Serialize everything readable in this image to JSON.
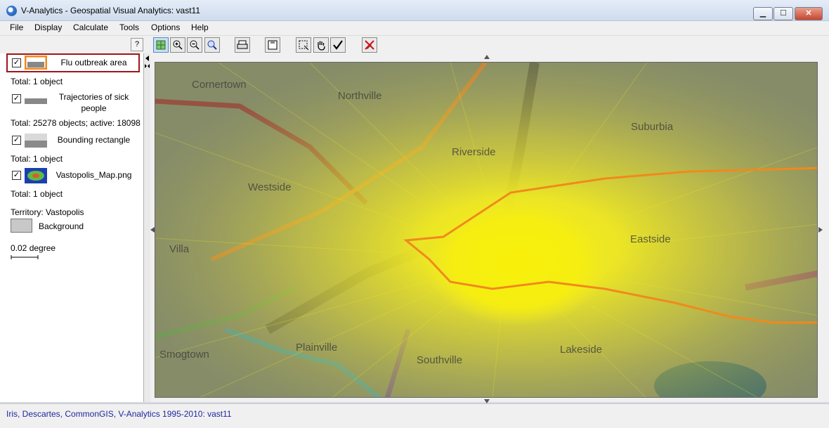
{
  "window": {
    "title": "V-Analytics - Geospatial Visual Analytics: vast11",
    "min_label": "▁",
    "max_label": "☐",
    "close_label": "✕"
  },
  "menu": [
    "File",
    "Display",
    "Calculate",
    "Tools",
    "Options",
    "Help"
  ],
  "toolbar": {
    "help_label": "?",
    "icons": [
      "fit-extent-icon",
      "zoom-in-icon",
      "zoom-out-icon",
      "pan-map-icon",
      "print-icon",
      "save-icon",
      "select-area-icon",
      "hand-icon",
      "checkmark-icon",
      "remove-selection-icon"
    ]
  },
  "legend": {
    "layers": [
      {
        "name": "Flu outbreak area",
        "total": "Total: 1 object",
        "checked": true,
        "selected": true
      },
      {
        "name": "Trajectories of sick people",
        "total": "Total: 25278 objects; active: 18098",
        "checked": true
      },
      {
        "name": "Bounding rectangle",
        "total": "Total: 1 object",
        "checked": true
      },
      {
        "name": "Vastopolis_Map.png",
        "total": "Total: 1 object",
        "checked": true
      }
    ],
    "territory": "Territory: Vastopolis",
    "background_label": "Background",
    "scale_label": "0.02 degree"
  },
  "map": {
    "districts": [
      {
        "name": "Cornertown"
      },
      {
        "name": "Northville"
      },
      {
        "name": "Suburbia"
      },
      {
        "name": "Riverside"
      },
      {
        "name": "Westside"
      },
      {
        "name": "Eastside"
      },
      {
        "name": "Villa"
      },
      {
        "name": "Smogtown"
      },
      {
        "name": "Plainville"
      },
      {
        "name": "Southville"
      },
      {
        "name": "Lakeside"
      }
    ],
    "colors": {
      "outbreak_outline": "#f08a1c",
      "trajectories": "#f5ee1a",
      "base": "#7b8a5e"
    }
  },
  "status": {
    "text": "Iris, Descartes, CommonGIS, V-Analytics 1995-2010: vast11"
  }
}
